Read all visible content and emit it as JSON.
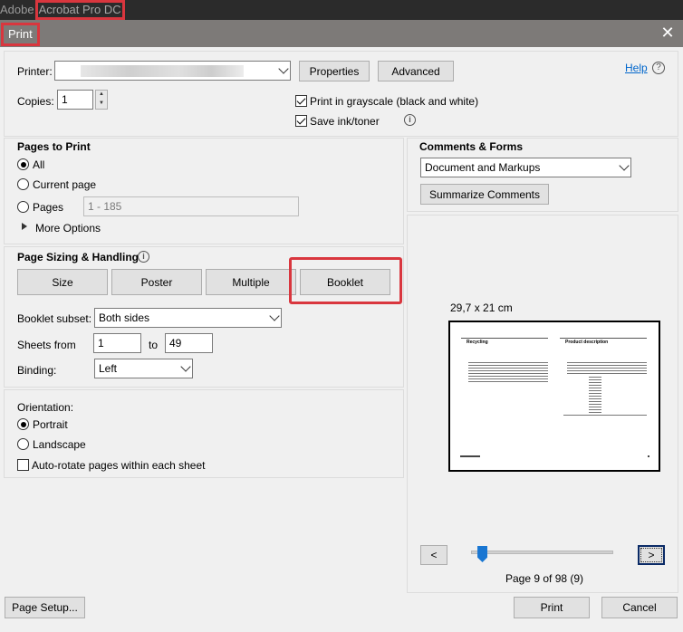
{
  "app": {
    "title_prefix": "Adobe",
    "title_rest": "Acrobat Pro DC"
  },
  "dialog": {
    "title": "Print",
    "close_icon": "close-icon"
  },
  "printer": {
    "label": "Printer:",
    "value": "",
    "properties_label": "Properties",
    "advanced_label": "Advanced",
    "help_label": "Help"
  },
  "copies": {
    "label": "Copies:",
    "value": "1"
  },
  "options": {
    "grayscale_label": "Print in grayscale (black and white)",
    "grayscale_checked": true,
    "save_ink_label": "Save ink/toner",
    "save_ink_checked": true
  },
  "pages_to_print": {
    "heading": "Pages to Print",
    "all_label": "All",
    "current_label": "Current page",
    "pages_label": "Pages",
    "pages_value": "1 - 185",
    "more_options_label": "More Options",
    "selected": "all"
  },
  "sizing": {
    "heading": "Page Sizing & Handling",
    "tabs": [
      "Size",
      "Poster",
      "Multiple",
      "Booklet"
    ],
    "active_tab": "Booklet",
    "booklet_subset_label": "Booklet subset:",
    "booklet_subset_value": "Both sides",
    "sheets_from_label": "Sheets from",
    "sheets_from_value": "1",
    "to_label": "to",
    "sheets_to_value": "49",
    "binding_label": "Binding:",
    "binding_value": "Left"
  },
  "orientation": {
    "heading": "Orientation:",
    "portrait_label": "Portrait",
    "landscape_label": "Landscape",
    "autorotate_label": "Auto-rotate pages within each sheet",
    "selected": "portrait",
    "autorotate_checked": false
  },
  "comments": {
    "heading": "Comments & Forms",
    "value": "Document and Markups",
    "summarize_label": "Summarize Comments"
  },
  "preview": {
    "size_label": "29,7 x 21 cm",
    "left_heading": "Recycling",
    "right_heading": "Product description",
    "prev_label": "<",
    "next_label": ">",
    "page_status": "Page 9 of 98 (9)",
    "slider_fraction": 0.08
  },
  "footer": {
    "page_setup_label": "Page Setup...",
    "print_label": "Print",
    "cancel_label": "Cancel"
  }
}
